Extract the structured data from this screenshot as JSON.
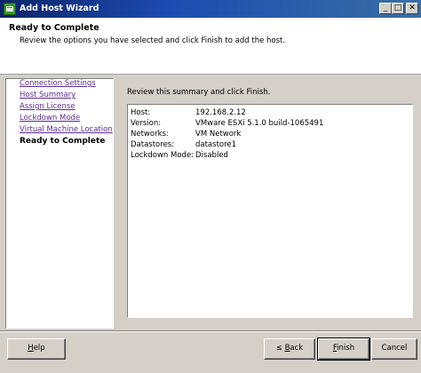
{
  "window": {
    "title": "Add Host Wizard",
    "minimize_glyph": "_",
    "maximize_glyph": "□",
    "close_glyph": "✕"
  },
  "header": {
    "title": "Ready to Complete",
    "subtitle": "Review the options you have selected and click Finish to add the host."
  },
  "nav": {
    "items": [
      {
        "label": "Connection Settings"
      },
      {
        "label": "Host Summary"
      },
      {
        "label": "Assign License"
      },
      {
        "label": "Lockdown Mode"
      },
      {
        "label": "Virtual Machine Location"
      },
      {
        "label": "Ready to Complete"
      }
    ]
  },
  "content": {
    "caption": "Review this summary and click Finish.",
    "summary": [
      {
        "key": "Host:",
        "value": "192.168.2.12"
      },
      {
        "key": "Version:",
        "value": "VMware ESXi 5.1.0 build-1065491"
      },
      {
        "key": "Networks:",
        "value": "VM Network"
      },
      {
        "key": "Datastores:",
        "value": "datastore1"
      },
      {
        "key": "Lockdown Mode:",
        "value": "Disabled"
      }
    ]
  },
  "buttons": {
    "help": {
      "mnemonic": "H",
      "rest": "elp"
    },
    "back": {
      "prefix": "≤ ",
      "mnemonic": "B",
      "rest": "ack"
    },
    "finish": {
      "mnemonic": "F",
      "rest": "inish"
    },
    "cancel": "Cancel"
  },
  "colors": {
    "titlebar": "#0a246a",
    "visited_link": "#5a2d91",
    "face": "#d4d0c8"
  },
  "icons": {
    "app": "vsphere-host-icon"
  }
}
